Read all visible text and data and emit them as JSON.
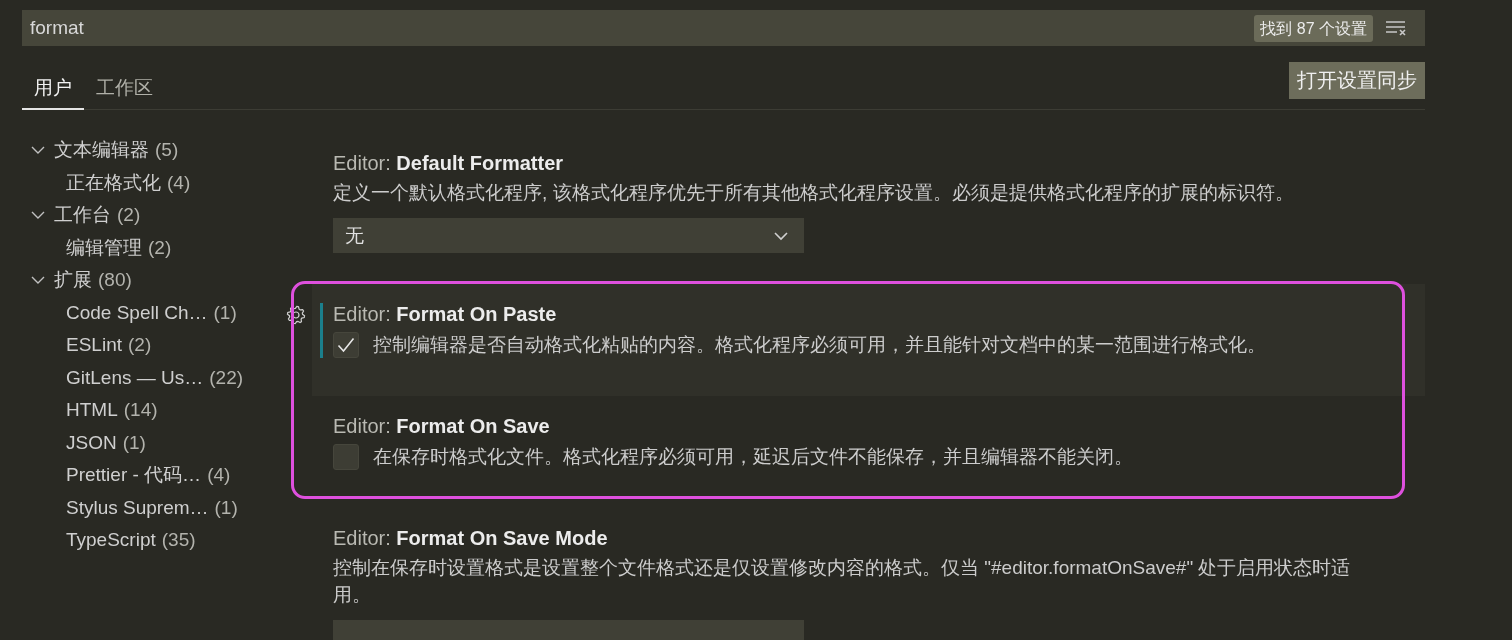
{
  "search": {
    "value": "format",
    "result_count": "找到 87 个设置"
  },
  "tabs": [
    {
      "label": "用户",
      "selected": true
    },
    {
      "label": "工作区",
      "selected": false
    }
  ],
  "sync_button": "打开设置同步",
  "toc": [
    {
      "label": "文本编辑器",
      "count": "(5)",
      "expanded": true,
      "children": [
        {
          "label": "正在格式化",
          "count": "(4)"
        }
      ]
    },
    {
      "label": "工作台",
      "count": "(2)",
      "expanded": true,
      "children": [
        {
          "label": "编辑管理",
          "count": "(2)"
        }
      ]
    },
    {
      "label": "扩展",
      "count": "(80)",
      "expanded": true,
      "children": [
        {
          "label": "Code Spell Ch…",
          "count": "(1)"
        },
        {
          "label": "ESLint",
          "count": "(2)"
        },
        {
          "label": "GitLens — Us…",
          "count": "(22)"
        },
        {
          "label": "HTML",
          "count": "(14)"
        },
        {
          "label": "JSON",
          "count": "(1)"
        },
        {
          "label": "Prettier - 代码…",
          "count": "(4)"
        },
        {
          "label": "Stylus Suprem…",
          "count": "(1)"
        },
        {
          "label": "TypeScript",
          "count": "(35)"
        }
      ]
    }
  ],
  "settings": [
    {
      "kind": "dropdown",
      "title": "Editor: **Default Formatter**",
      "description": "定义一个默认格式化程序, 该格式化程序优先于所有其他格式化程序设置。必须是提供格式化程序的扩展的标识符。",
      "value": "无",
      "focused": false,
      "highlighted": false
    },
    {
      "kind": "checkbox",
      "title": "Editor: **Format On Paste**",
      "description": "控制编辑器是否自动格式化粘贴的内容。格式化程序必须可用，并且能针对文档中的某一范围进行格式化。",
      "checked": true,
      "focused": true,
      "highlighted": true
    },
    {
      "kind": "checkbox",
      "title": "Editor: **Format On Save**",
      "description": "在保存时格式化文件。格式化程序必须可用，延迟后文件不能保存，并且编辑器不能关闭。",
      "checked": false,
      "focused": false,
      "highlighted": true
    },
    {
      "kind": "dropdown",
      "title": "Editor: **Format On Save Mode**",
      "description": "控制在保存时设置格式是设置整个文件格式还是仅设置修改内容的格式。仅当 \"#editor.formatOnSave#\" 处于启用状态时适用。",
      "focused": false,
      "highlighted": false
    }
  ]
}
